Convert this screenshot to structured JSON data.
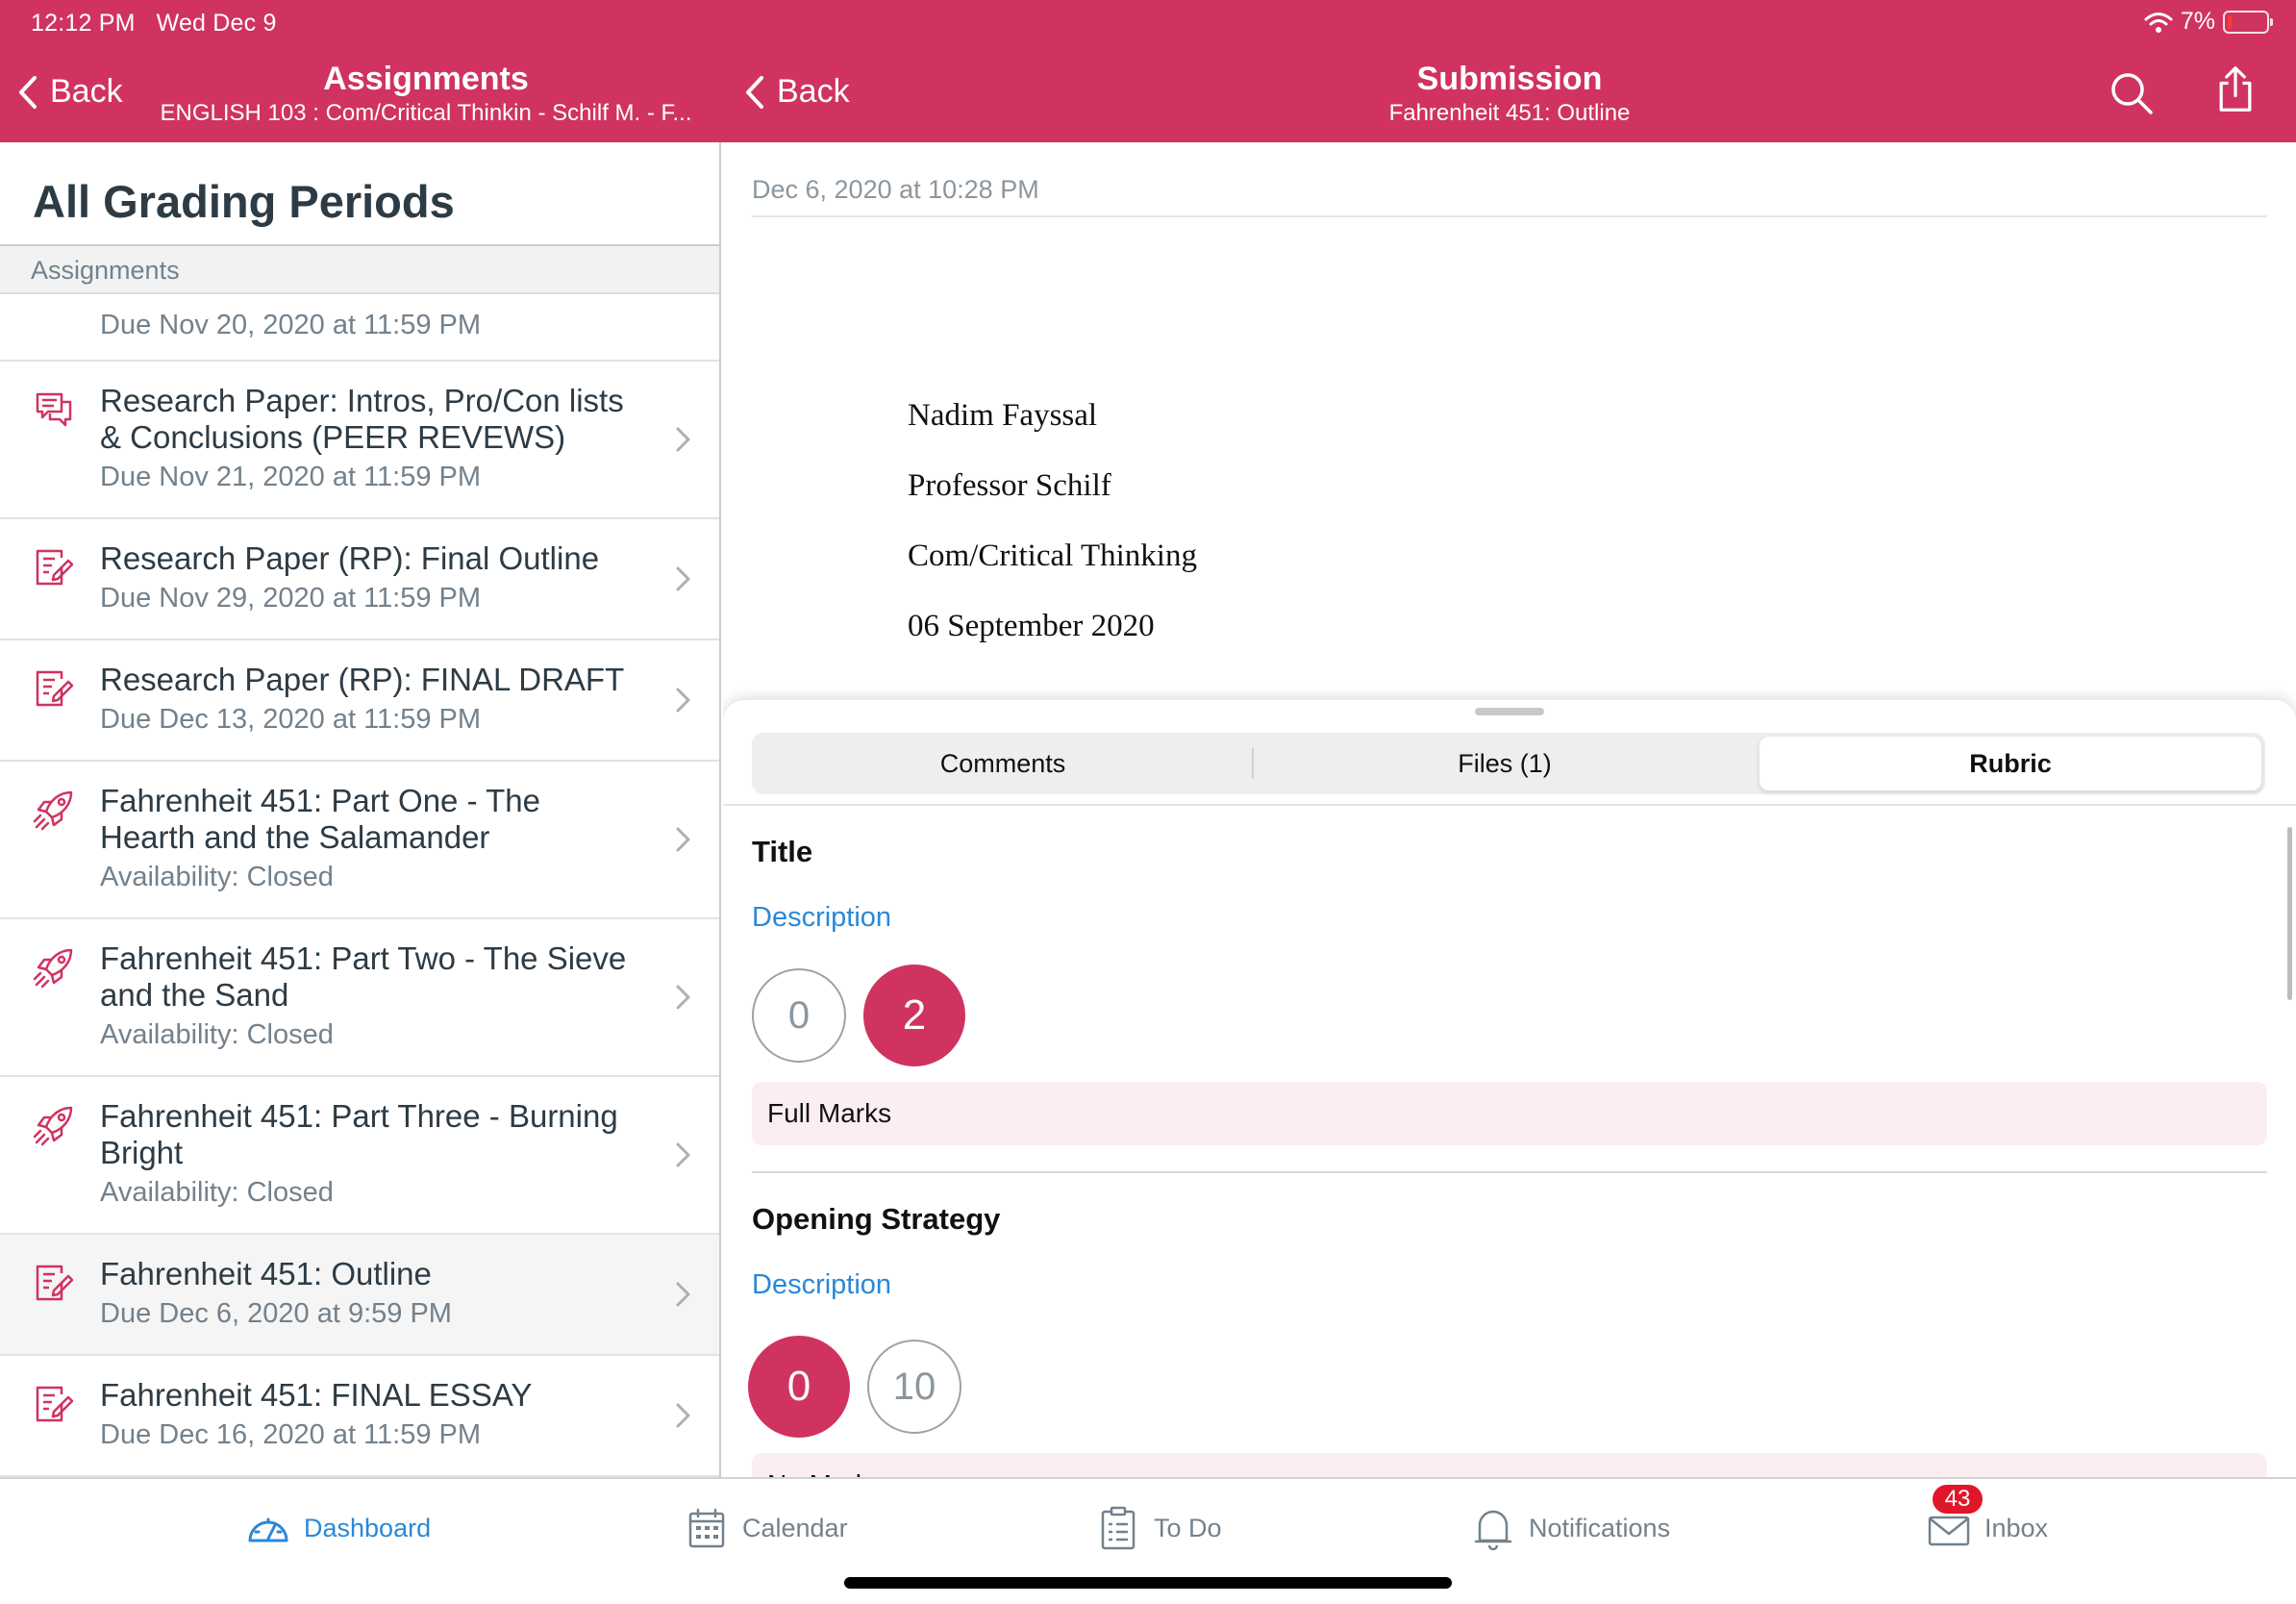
{
  "status_bar": {
    "time": "12:12 PM",
    "date": "Wed Dec 9",
    "battery": "7%"
  },
  "left_nav": {
    "back_label": "Back",
    "title": "Assignments",
    "subtitle": "ENGLISH 103 : Com/Critical Thinkin - Schilf M. - F..."
  },
  "right_nav": {
    "back_label": "Back",
    "title": "Submission",
    "subtitle": "Fahrenheit 451: Outline",
    "search_icon": "search-icon",
    "share_icon": "share-icon"
  },
  "left_panel": {
    "heading": "All Grading Periods",
    "section_header": "Assignments",
    "partial_item": {
      "subtitle": "Due Nov 20, 2020 at 11:59 PM"
    },
    "items": [
      {
        "title": "Research Paper: Intros, Pro/Con lists & Conclusions (PEER REVEWS)",
        "subtitle": "Due Nov 21, 2020 at 11:59 PM",
        "icon": "discussion-icon"
      },
      {
        "title": "Research Paper (RP): Final Outline",
        "subtitle": "Due Nov 29, 2020 at 11:59 PM",
        "icon": "assignment-icon"
      },
      {
        "title": "Research Paper (RP): FINAL DRAFT",
        "subtitle": "Due Dec 13, 2020 at 11:59 PM",
        "icon": "assignment-icon"
      },
      {
        "title": "Fahrenheit 451: Part One - The Hearth and the Salamander",
        "subtitle": "Availability: Closed",
        "icon": "quiz-rocket-icon"
      },
      {
        "title": "Fahrenheit 451: Part Two - The Sieve and the Sand",
        "subtitle": "Availability: Closed",
        "icon": "quiz-rocket-icon"
      },
      {
        "title": "Fahrenheit 451: Part Three - Burning Bright",
        "subtitle": "Availability: Closed",
        "icon": "quiz-rocket-icon"
      },
      {
        "title": "Fahrenheit 451: Outline",
        "subtitle": "Due Dec 6, 2020 at 9:59 PM",
        "icon": "assignment-icon",
        "selected": true
      },
      {
        "title": "Fahrenheit 451: FINAL ESSAY",
        "subtitle": "Due Dec 16, 2020 at 11:59 PM",
        "icon": "assignment-icon"
      }
    ]
  },
  "submission": {
    "date": "Dec 6, 2020 at 10:28 PM",
    "document_lines": [
      "Nadim Fayssal",
      "Professor Schilf",
      "Com/Critical Thinking",
      "06 September 2020"
    ]
  },
  "sheet": {
    "tabs": [
      "Comments",
      "Files (1)",
      "Rubric"
    ],
    "active_tab": "Rubric",
    "criteria": [
      {
        "title": "Title",
        "description_link": "Description",
        "points": [
          "0",
          "2"
        ],
        "selected": "2",
        "rating": "Full Marks"
      },
      {
        "title": "Opening Strategy",
        "description_link": "Description",
        "points": [
          "0",
          "10"
        ],
        "selected": "0",
        "rating": "No Marks"
      }
    ]
  },
  "tabbar": {
    "items": [
      {
        "label": "Dashboard",
        "icon": "dashboard-icon",
        "active": true
      },
      {
        "label": "Calendar",
        "icon": "calendar-icon"
      },
      {
        "label": "To Do",
        "icon": "todo-icon"
      },
      {
        "label": "Notifications",
        "icon": "bell-icon"
      },
      {
        "label": "Inbox",
        "icon": "inbox-icon",
        "badge": "43"
      }
    ]
  },
  "colors": {
    "brand": "#d03360",
    "link": "#2a88d8",
    "text": "#2d3b45",
    "muted": "#73818c",
    "rating_bg": "#fbeef2"
  }
}
